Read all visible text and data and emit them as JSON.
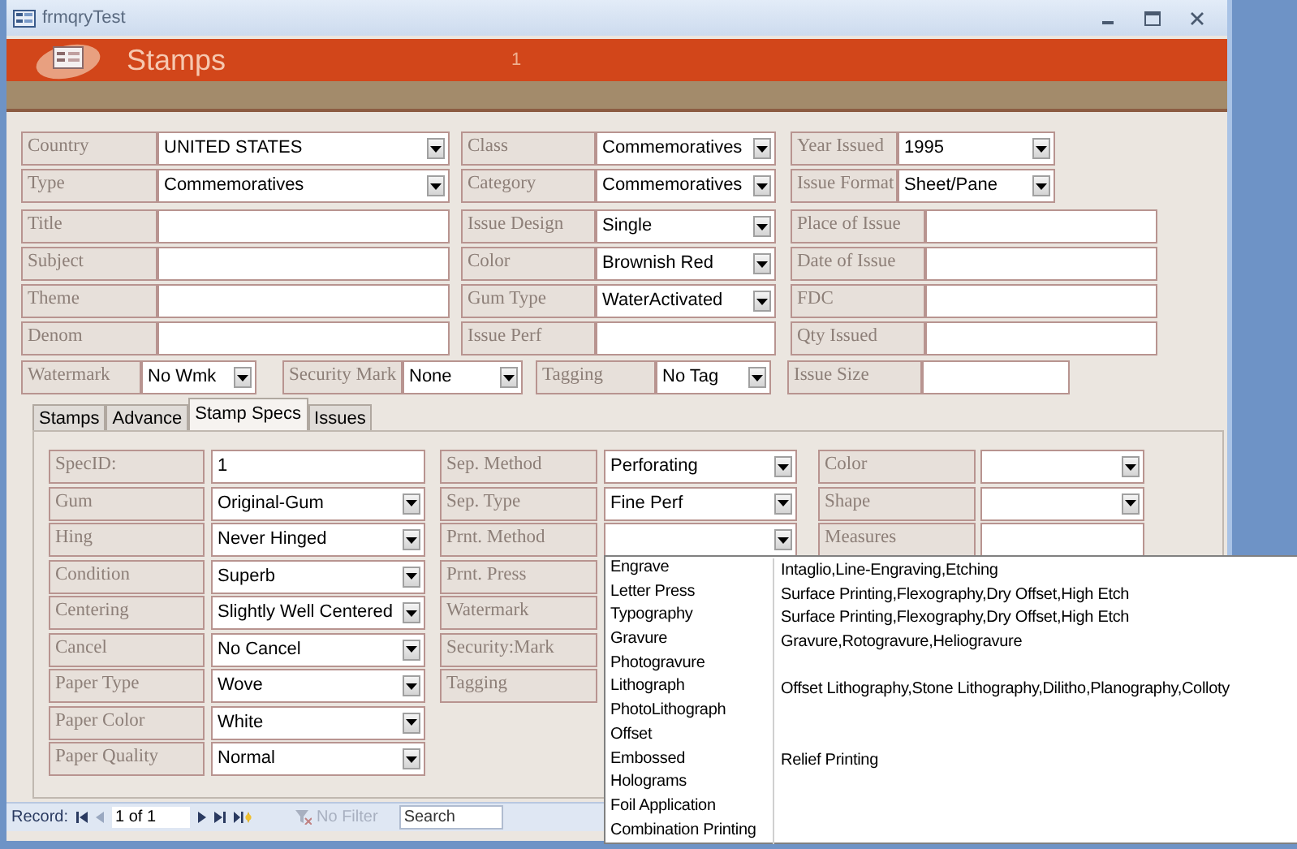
{
  "window": {
    "title": "frmqryTest"
  },
  "header": {
    "title": "Stamps",
    "record_number": "1"
  },
  "main_columns": [
    [
      {
        "label": "Country",
        "kind": "combo",
        "value": "UNITED STATES"
      },
      {
        "label": "Type",
        "kind": "combo",
        "value": "Commemoratives"
      },
      {
        "label": "Title",
        "kind": "text"
      },
      {
        "label": "Subject",
        "kind": "text"
      },
      {
        "label": "Theme",
        "kind": "text"
      },
      {
        "label": "Denom",
        "kind": "text"
      }
    ],
    [
      {
        "label": "Class",
        "kind": "combo",
        "value": "Commemoratives"
      },
      {
        "label": "Category",
        "kind": "combo",
        "value": "Commemoratives"
      },
      {
        "label": "Issue Design",
        "kind": "combo",
        "value": "Single"
      },
      {
        "label": "Color",
        "kind": "combo",
        "value": "Brownish Red"
      },
      {
        "label": "Gum Type",
        "kind": "combo",
        "value": "WaterActivated"
      },
      {
        "label": "Issue Perf",
        "kind": "text"
      }
    ],
    [
      {
        "label": "Year Issued",
        "kind": "combo",
        "value": "1995"
      },
      {
        "label": "Issue Format",
        "kind": "combo",
        "value": "Sheet/Pane"
      },
      {
        "label": "Place of Issue",
        "kind": "text"
      },
      {
        "label": "Date of Issue",
        "kind": "text"
      },
      {
        "label": "FDC",
        "kind": "text"
      },
      {
        "label": "Qty Issued",
        "kind": "text"
      }
    ]
  ],
  "main_bottom_row": [
    {
      "label": "Watermark",
      "kind": "combo",
      "value": "No Wmk"
    },
    {
      "label": "Security Mark",
      "kind": "combo",
      "value": "None"
    },
    {
      "label": "Tagging",
      "kind": "combo",
      "value": "No Tag"
    },
    {
      "label": "Issue Size",
      "kind": "text"
    }
  ],
  "tabs": [
    {
      "label": "Stamps",
      "selected": false
    },
    {
      "label": "Advance",
      "selected": false
    },
    {
      "label": "Stamp Specs",
      "selected": true
    },
    {
      "label": "Issues",
      "selected": false
    }
  ],
  "spec_columns": [
    [
      {
        "label": "SpecID:",
        "kind": "text",
        "value": "1"
      },
      {
        "label": "Gum",
        "kind": "combo",
        "value": "Original-Gum"
      },
      {
        "label": "Hing",
        "kind": "combo",
        "value": "Never Hinged"
      },
      {
        "label": "Condition",
        "kind": "combo",
        "value": "Superb"
      },
      {
        "label": "Centering",
        "kind": "combo",
        "value": "Slightly Well Centered"
      },
      {
        "label": "Cancel",
        "kind": "combo",
        "value": "No Cancel"
      },
      {
        "label": "Paper Type",
        "kind": "combo",
        "value": "Wove"
      },
      {
        "label": "Paper Color",
        "kind": "combo",
        "value": "White"
      },
      {
        "label": "Paper Quality",
        "kind": "combo",
        "value": "Normal"
      }
    ],
    [
      {
        "label": "Sep. Method",
        "kind": "combo",
        "value": "Perforating"
      },
      {
        "label": "Sep. Type",
        "kind": "combo",
        "value": "Fine Perf"
      },
      {
        "label": "Prnt. Method",
        "kind": "combo",
        "options": [
          {
            "name": "Engrave",
            "variants": "Intaglio,Line-Engraving,Etching"
          },
          {
            "name": "Letter Press",
            "variants": "Surface Printing,Flexography,Dry Offset,High Etch"
          },
          {
            "name": "Typography",
            "variants": "Surface Printing,Flexography,Dry Offset,High Etch"
          },
          {
            "name": "Gravure",
            "variants": "Gravure,Rotogravure,Heliogravure"
          },
          {
            "name": "Photogravure"
          },
          {
            "name": "Lithograph",
            "variants": "Offset Lithography,Stone Lithography,Dilitho,Planography,Colloty"
          },
          {
            "name": "PhotoLithograph"
          },
          {
            "name": "Offset"
          },
          {
            "name": "Embossed",
            "variants": "Relief Printing"
          },
          {
            "name": "Holograms"
          },
          {
            "name": "Foil Application"
          },
          {
            "name": "Combination Printing"
          }
        ]
      },
      {
        "label": "Prnt. Press",
        "kind": "label"
      },
      {
        "label": "Watermark",
        "kind": "label"
      },
      {
        "label": "Security:Mark",
        "kind": "label"
      },
      {
        "label": "Tagging",
        "kind": "label"
      }
    ],
    [
      {
        "label": "Color",
        "kind": "combo"
      },
      {
        "label": "Shape",
        "kind": "combo"
      },
      {
        "label": "Measures",
        "kind": "text"
      }
    ]
  ],
  "navigation": {
    "label": "Record:",
    "position": "1 of 1",
    "filter": {
      "label": "No Filter",
      "disabled": true
    },
    "search_placeholder": "Search"
  }
}
